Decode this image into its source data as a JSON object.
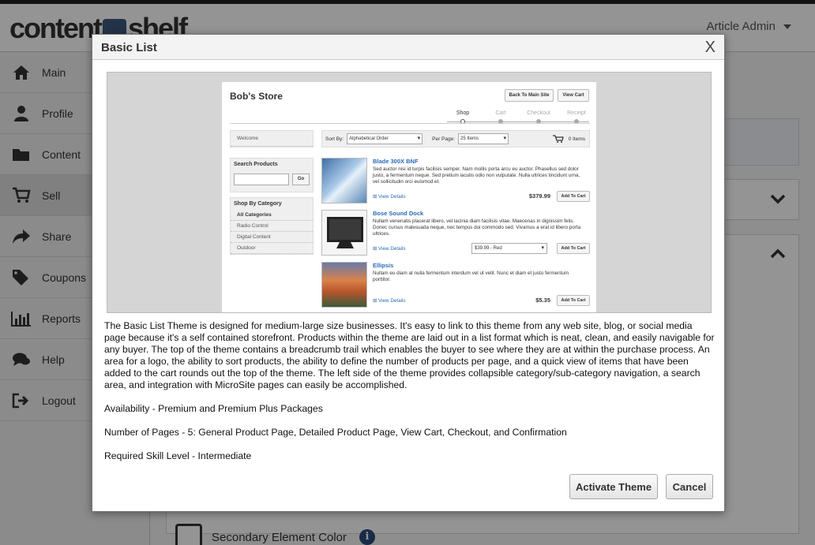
{
  "app": {
    "logo_left": "content",
    "logo_right": "shelf",
    "user_menu": "Article Admin"
  },
  "sidebar": {
    "items": [
      {
        "label": "Main",
        "icon": "home-icon"
      },
      {
        "label": "Profile",
        "icon": "user-icon"
      },
      {
        "label": "Content",
        "icon": "folder-icon"
      },
      {
        "label": "Sell",
        "icon": "cart-icon"
      },
      {
        "label": "Share",
        "icon": "share-icon"
      },
      {
        "label": "Coupons",
        "icon": "tags-icon"
      },
      {
        "label": "Reports",
        "icon": "bar-chart-icon"
      },
      {
        "label": "Help",
        "icon": "chat-icon"
      },
      {
        "label": "Logout",
        "icon": "logout-icon"
      }
    ],
    "active_index": 3
  },
  "background": {
    "secondary_color_label": "Secondary Element Color"
  },
  "modal": {
    "title": "Basic List",
    "close": "X",
    "preview": {
      "store_title": "Bob's Store",
      "back_button": "Back To Main Site",
      "view_cart_button": "View Cart",
      "steps": [
        "Shop",
        "Cart",
        "Checkout",
        "Receipt"
      ],
      "welcome": "Welcome",
      "sort_label": "Sort By:",
      "sort_value": "Alphabetical Order",
      "per_page_label": "Per Page:",
      "per_page_value": "25 Items",
      "cart_count": "0 Items",
      "search_heading": "Search Products",
      "search_go": "Go",
      "category_heading": "Shop By Category",
      "categories": [
        "All Categories",
        "Radio Control",
        "Digital Content",
        "Outdoor"
      ],
      "products": [
        {
          "name": "Blade 300X BNF",
          "desc": "Sed auctor nisi id turpis facilisis semper. Nam mollis porta arcu eu auctor. Phasellus sed dolor justo, a fermentum neque. Sed pretium iaculis odio non vulputate. Nulla ultrices tincidunt urna, vel sollicitudin orci euismod et.",
          "price": "$379.99",
          "option": ""
        },
        {
          "name": "Bose Sound Dock",
          "desc": "Nullam venenatis placerat libero, vel lacinia diam facilisis vitae. Maecenas in dignissim felis. Donec cursus malesuada neque, nec tempus dui commodo sed. Vivamus a erat id libero porta ultrices.",
          "price": "",
          "option": "$39.99 - Red"
        },
        {
          "name": "Ellipsis",
          "desc": "Nullam eu diam at nulla fermentum interdum vel ut velit. Nunc et diam et justo fermentum porttitor.",
          "price": "$5.35",
          "option": ""
        }
      ],
      "view_details": "View Details",
      "add_to_cart": "Add To Cart"
    },
    "description": [
      "The Basic List Theme is designed for medium-large size businesses. It's easy to link to this theme from any web site, blog, or social media page because it's a self contained storefront. Products within the theme are laid out in a list format which is neat, clean, and easily navigable for any buyer. The top of the theme contains a breadcrumb trail which enables the buyer to see where they are at within the purchase process. An area for a logo, the ability to sort products, the ability to define the number of products per page, and a quick view of items that have been added to the cart rounds out the top of the theme. The left side of the theme provides collapsible category/sub-category navigation, a search area, and integration with MicroSite pages can easily be accomplished.",
      "Availability - Premium and Premium Plus Packages",
      "Number of Pages - 5: General Product Page, Detailed Product Page, View Cart, Checkout, and Confirmation",
      "Required Skill Level - Intermediate"
    ],
    "activate_button": "Activate Theme",
    "cancel_button": "Cancel"
  }
}
